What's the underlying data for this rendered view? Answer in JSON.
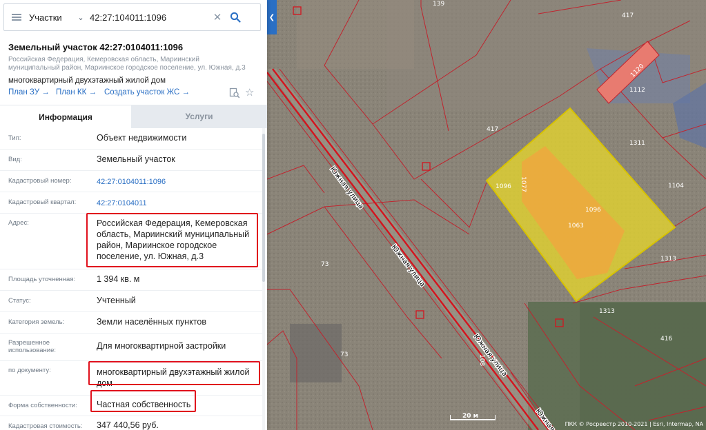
{
  "search": {
    "type": "Участки",
    "query": "42:27:104011:1096"
  },
  "card": {
    "title": "Земельный участок 42:27:0104011:1096",
    "address_sub": "Российская Федерация, Кемеровская область, Мариинский муниципальный район, Мариинское городское поселение, ул. Южная, д.3",
    "purpose": "многоквартирный двухэтажный жилой дом",
    "links": {
      "plan_zu": "План ЗУ",
      "plan_kk": "План КК",
      "create_zhs": "Создать участок ЖС"
    }
  },
  "tabs": {
    "info": "Информация",
    "services": "Услуги"
  },
  "info": {
    "type": {
      "label": "Тип:",
      "value": "Объект недвижимости"
    },
    "kind": {
      "label": "Вид:",
      "value": "Земельный участок"
    },
    "cad_number": {
      "label": "Кадастровый номер:",
      "value": "42:27:0104011:1096"
    },
    "cad_quarter": {
      "label": "Кадастровый квартал:",
      "value": "42:27:0104011"
    },
    "address": {
      "label": "Адрес:",
      "value": "Российская Федерация, Кемеровская область, Мариинский муниципальный район, Мариинское городское поселение, ул. Южная, д.3"
    },
    "area": {
      "label": "Площадь уточненная:",
      "value": "1 394 кв. м"
    },
    "status": {
      "label": "Статус:",
      "value": "Учтенный"
    },
    "category": {
      "label": "Категория земель:",
      "value": "Земли населённых пунктов"
    },
    "permitted_use": {
      "label": "Разрешенное использование:",
      "value": "Для многоквартирной застройки"
    },
    "by_document": {
      "label": "по документу:",
      "value": "многоквартирный двухэтажный жилой дом"
    },
    "ownership": {
      "label": "Форма собственности:",
      "value": "Частная собственность"
    },
    "cad_value": {
      "label": "Кадастровая стоимость:",
      "value": "347 440,56 руб."
    }
  },
  "map": {
    "parcel_labels": {
      "p139": "139",
      "p417a": "417",
      "p417b": "417",
      "p1120": "1120",
      "p1112": "1112",
      "p1311": "1311",
      "p1104": "1104",
      "p1096a": "1096",
      "p1096b": "1096",
      "p1063": "1063",
      "p1077": "1077",
      "p73a": "73",
      "p73b": "73",
      "p1313a": "1313",
      "p1313b": "1313",
      "p416": "416",
      "p108": "108"
    },
    "street_name": "Южная улица",
    "street_name_cut": "Южная",
    "scale": "20 м",
    "attribution": "ПКК © Росреестр 2010-2021 | Esri, Intermap, NA"
  },
  "colors": {
    "accent": "#2a6fc4",
    "highlight": "#e0101c",
    "parcel_border": "#c0242e",
    "selected_fill": "#e8d82a"
  }
}
